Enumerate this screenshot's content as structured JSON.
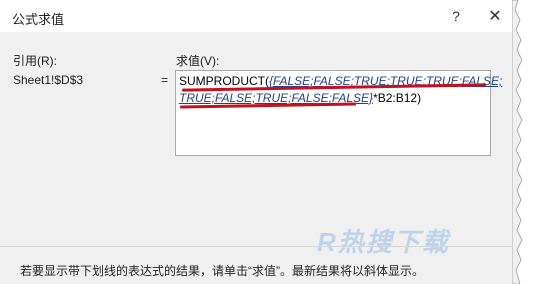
{
  "dialog": {
    "title": "公式求值",
    "help_glyph": "?",
    "close_glyph": "✕"
  },
  "labels": {
    "reference": "引用(R):",
    "evaluation": "求值(V):",
    "equals": "="
  },
  "reference_value": "Sheet1!$D$3",
  "evaluation": {
    "prefix": "SUMPRODUCT(",
    "line1_italic": "{FALSE;FALSE;TRUE;TRUE;TRUE;FALSE;",
    "line2_italic": "TRUE;FALSE;TRUE;FALSE;FALSE}",
    "suffix": "*B2:B12)"
  },
  "footer_message": "若要显示带下划线的表达式的结果，请单击“求值”。最新结果将以斜体显示。",
  "watermark": "R热搜下载"
}
